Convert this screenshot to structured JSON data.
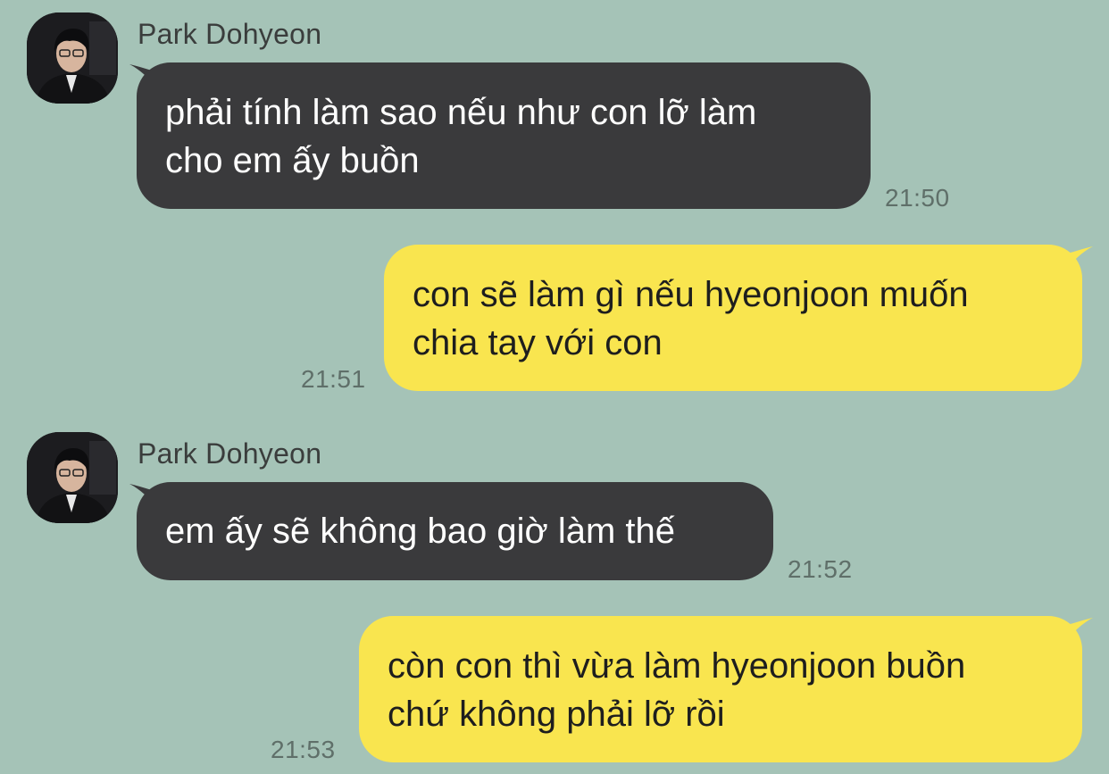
{
  "colors": {
    "background": "#a5c3b7",
    "incoming_bubble": "#3a3a3c",
    "outgoing_bubble": "#f9e54f",
    "timestamp": "#5f6f69"
  },
  "messages": [
    {
      "direction": "incoming",
      "sender": "Park Dohyeon",
      "avatar_icon": "profile-photo",
      "lines": [
        "phải tính làm sao nếu như con lỡ làm",
        "cho em ấy buồn"
      ],
      "time": "21:50"
    },
    {
      "direction": "outgoing",
      "lines": [
        "con sẽ làm gì nếu hyeonjoon muốn",
        "chia tay với con"
      ],
      "time": "21:51"
    },
    {
      "direction": "incoming",
      "sender": "Park Dohyeon",
      "avatar_icon": "profile-photo",
      "lines": [
        "em ấy sẽ không bao giờ làm thế"
      ],
      "time": "21:52"
    },
    {
      "direction": "outgoing",
      "lines": [
        "còn con thì vừa làm hyeonjoon buồn",
        "chứ không phải lỡ rồi"
      ],
      "time": "21:53"
    }
  ]
}
